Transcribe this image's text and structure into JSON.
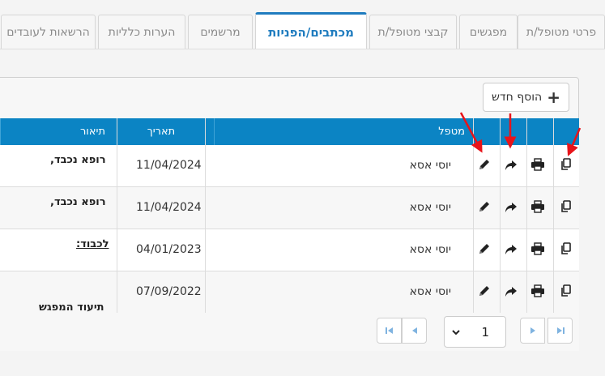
{
  "tabs": [
    {
      "label": "פרטי מטופל/ת",
      "active": false
    },
    {
      "label": "מפגשים",
      "active": false
    },
    {
      "label": "קבצי מטופל/ת",
      "active": false
    },
    {
      "label": "מכתבים/הפניות",
      "active": true
    },
    {
      "label": "מרשמים",
      "active": false
    },
    {
      "label": "הערות כלליות",
      "active": false
    },
    {
      "label": "הרשאות לעובדים",
      "active": false
    }
  ],
  "toolbar": {
    "add_label": "הוסף חדש",
    "add_icon": "plus-icon"
  },
  "table": {
    "columns": {
      "therapist": "מטפל",
      "date": "תאריך",
      "description": "תיאור"
    },
    "rows": [
      {
        "therapist": "יוסי אסא",
        "date": "11/04/2024",
        "description": "רופא נכבד,",
        "desc_style": "top"
      },
      {
        "therapist": "יוסי אסא",
        "date": "11/04/2024",
        "description": "רופא נכבד,",
        "desc_style": "top"
      },
      {
        "therapist": "יוסי אסא",
        "date": "04/01/2023",
        "description": "לכבוד:",
        "desc_style": "underline"
      },
      {
        "therapist": "יוסי אסא",
        "date": "07/09/2022",
        "description": "תיעוד המפגש",
        "desc_style": "bottom"
      }
    ],
    "row_icons": [
      "copy-icon",
      "print-icon",
      "share-icon",
      "edit-icon"
    ]
  },
  "pager": {
    "page": "1"
  },
  "colors": {
    "header": "#0b84c4",
    "active_tab": "#1f7cbf",
    "annotation": "#e8141a"
  }
}
